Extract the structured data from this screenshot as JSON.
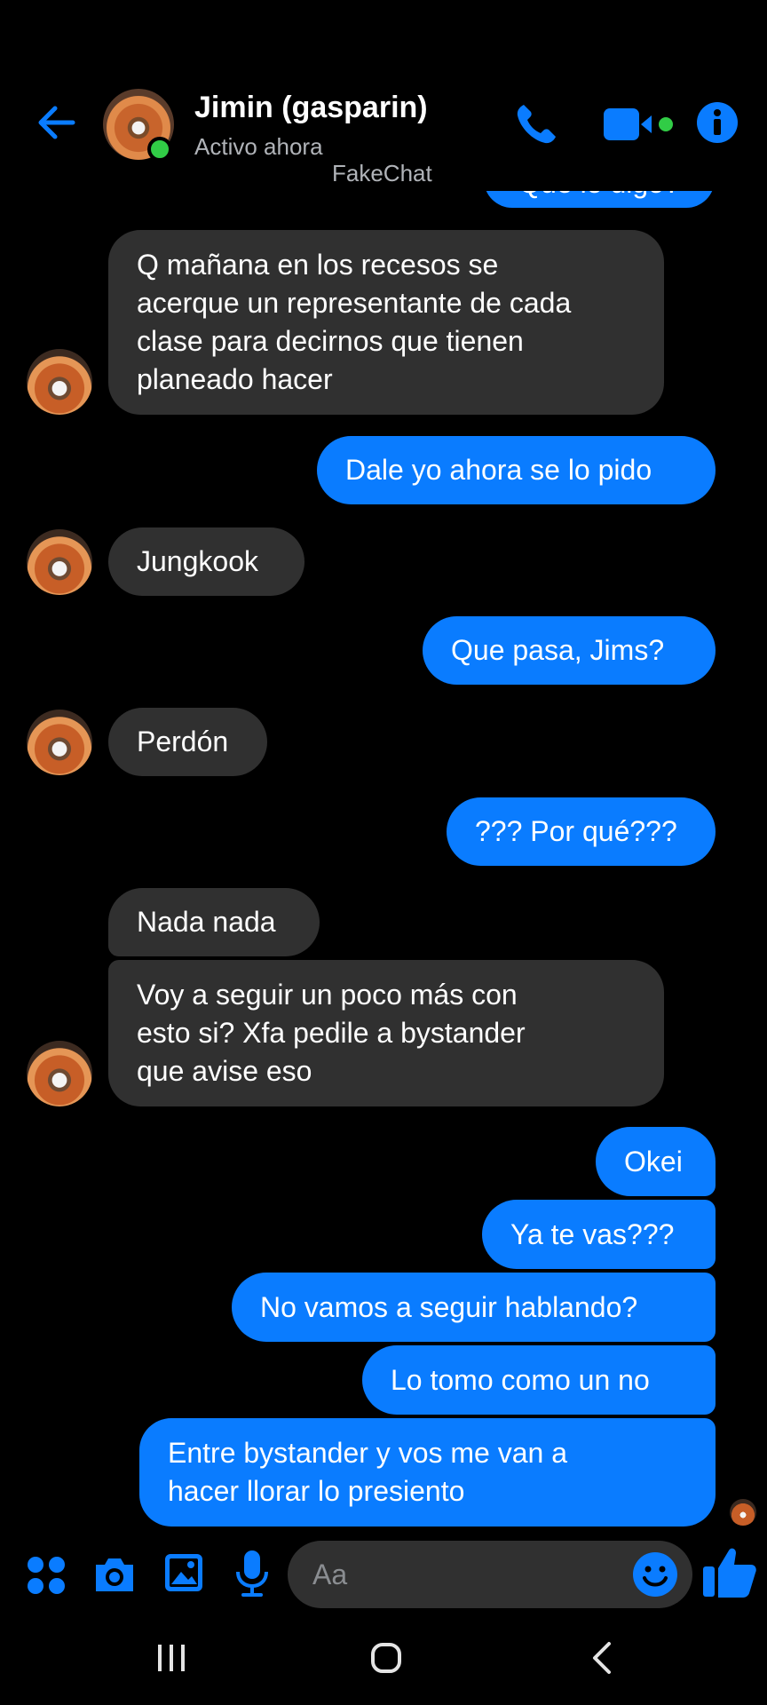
{
  "header": {
    "contact_name": "Jimin (gasparin)",
    "status": "Activo ahora",
    "watermark": "FakeChat"
  },
  "messages": {
    "partial_top": "Que lo digo?",
    "m1": [
      "Q mañana en los recesos se",
      "acerque un representante de cada",
      "clase para decirnos que tienen",
      "planeado hacer"
    ],
    "m2": "Dale yo ahora se lo pido",
    "m3": "Jungkook",
    "m4": "Que pasa, Jims?",
    "m5": "Perdón",
    "m6": "??? Por qué???",
    "m7": "Nada nada",
    "m8": [
      "Voy a seguir un poco más con",
      "esto si? Xfa pedile a bystander",
      "que avise eso"
    ],
    "m9": "Okei",
    "m10": "Ya te vas???",
    "m11": "No vamos a seguir hablando?",
    "m12": "Lo tomo como un no",
    "m13": [
      "Entre bystander y vos me van a",
      "hacer llorar lo presiento"
    ]
  },
  "composer": {
    "placeholder": "Aa"
  },
  "colors": {
    "accent": "#0a7cff",
    "incoming": "#303030",
    "online": "#31cc46"
  }
}
